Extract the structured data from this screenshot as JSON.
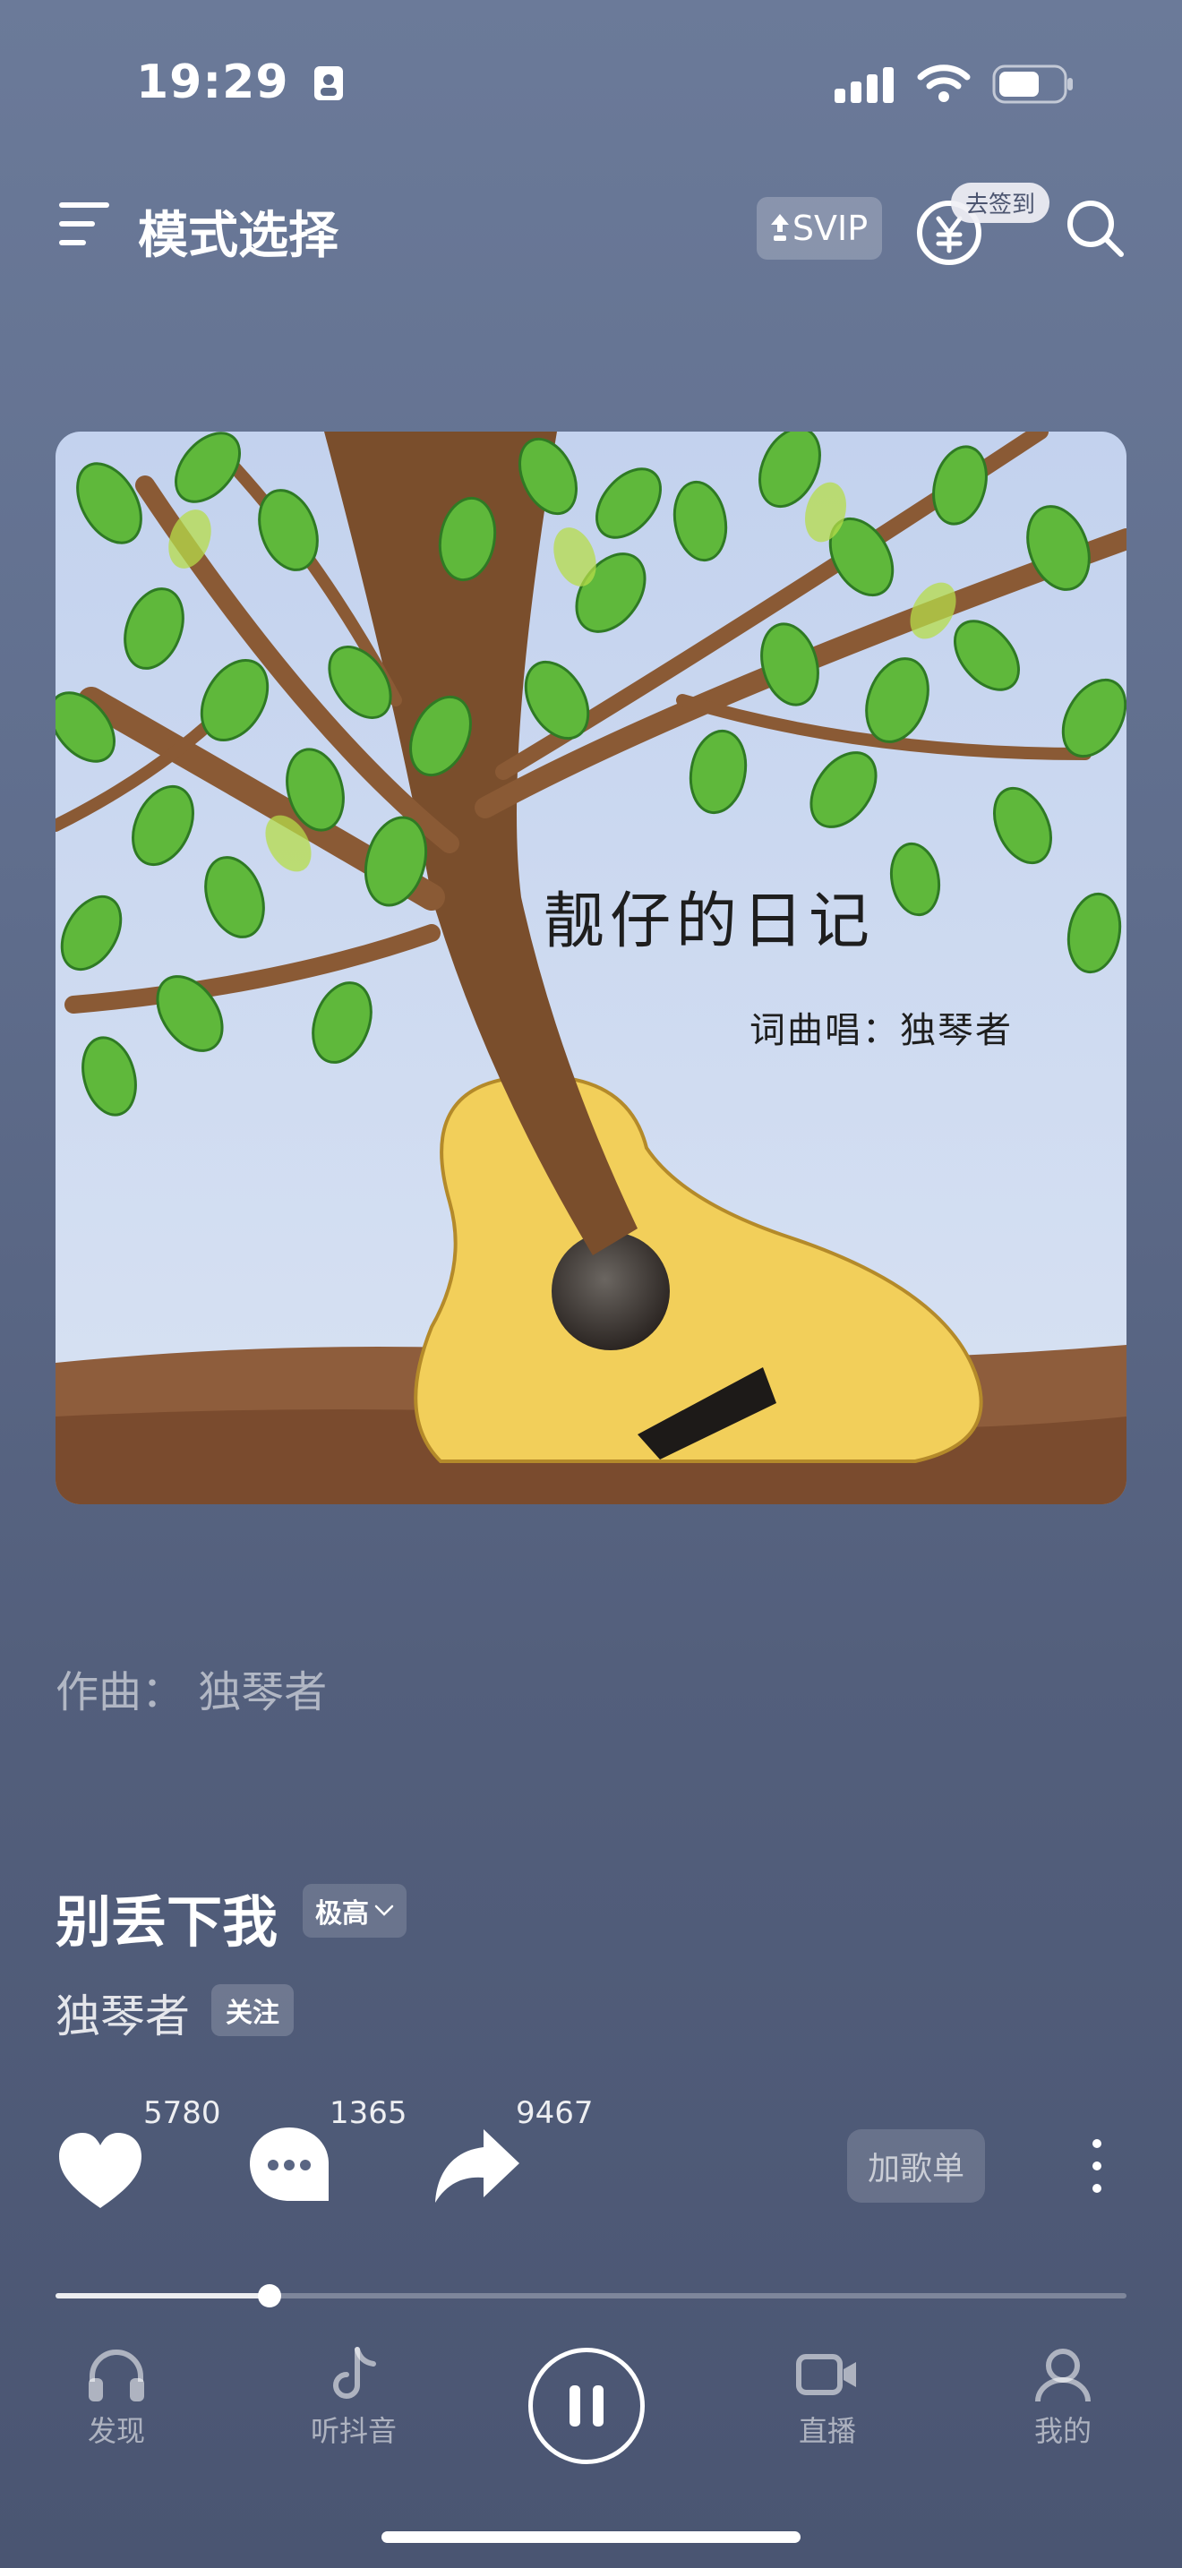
{
  "status_bar": {
    "time": "19:29"
  },
  "top_bar": {
    "title": "模式选择",
    "svip_label": "SVIP",
    "checkin_badge": "去签到"
  },
  "cover": {
    "title": "靓仔的日记",
    "credit": "词曲唱：独琴者",
    "colors": {
      "sky": "#c9d7ef",
      "ground": "#8a5a3a",
      "guitar": "#f2cf5a",
      "trunk": "#7a4e2c",
      "leaf": "#5cb83a"
    }
  },
  "composer_line": "作曲：  独琴者",
  "song": {
    "title": "别丢下我",
    "quality": "极高",
    "artist": "独琴者",
    "follow_label": "关注"
  },
  "actions": {
    "like_count": "5780",
    "comment_count": "1365",
    "share_count": "9467",
    "add_playlist_label": "加歌单"
  },
  "progress": {
    "fraction": 0.2
  },
  "bottom_nav": {
    "items": [
      {
        "label": "发现",
        "icon": "headphones-icon"
      },
      {
        "label": "听抖音",
        "icon": "tiktok-note-icon"
      },
      {
        "label": "直播",
        "icon": "video-camera-icon"
      },
      {
        "label": "我的",
        "icon": "user-icon"
      }
    ],
    "play_state": "playing"
  }
}
